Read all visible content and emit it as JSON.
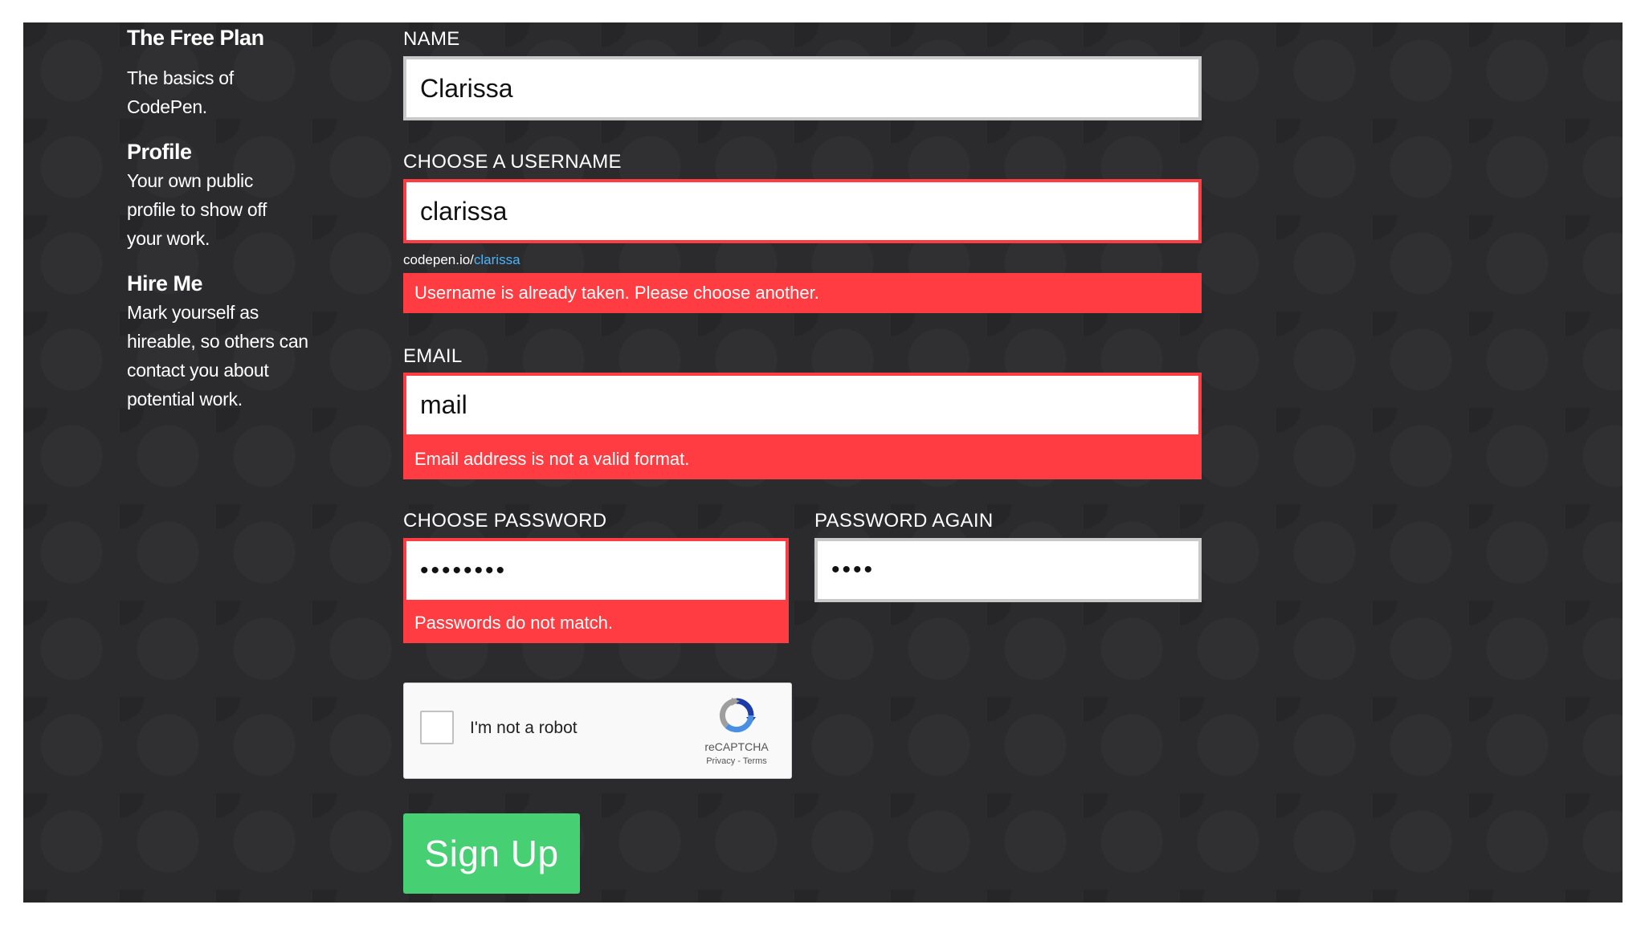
{
  "sidebar": {
    "plan_title": "The Free Plan",
    "plan_desc_line1": "The basics of",
    "plan_desc_line2": "CodePen.",
    "profile_title": "Profile",
    "profile_lines": [
      "Your own public",
      "profile to show off",
      "your work."
    ],
    "hire_title": "Hire Me",
    "hire_lines": [
      "Mark yourself as",
      "hireable, so others can",
      "contact you about",
      "potential work."
    ]
  },
  "form": {
    "name": {
      "label": "NAME",
      "value": "Clarissa"
    },
    "username": {
      "label": "CHOOSE A USERNAME",
      "value": "clarissa",
      "url_prefix": "codepen.io/",
      "url_user": "clarissa",
      "error": "Username is already taken. Please choose another."
    },
    "email": {
      "label": "EMAIL",
      "value": "mail",
      "error": "Email address is not a valid format."
    },
    "password": {
      "label": "CHOOSE PASSWORD",
      "masked": "••••••••",
      "error": "Passwords do not match."
    },
    "password_again": {
      "label": "PASSWORD AGAIN",
      "masked": "••••"
    },
    "captcha": {
      "label": "I'm not a robot",
      "brand": "reCAPTCHA",
      "links": "Privacy - Terms"
    },
    "submit_label": "Sign Up"
  },
  "colors": {
    "background": "#2b2b2d",
    "error": "#ff3c41",
    "submit": "#47cf73",
    "link": "#47b5ff"
  }
}
